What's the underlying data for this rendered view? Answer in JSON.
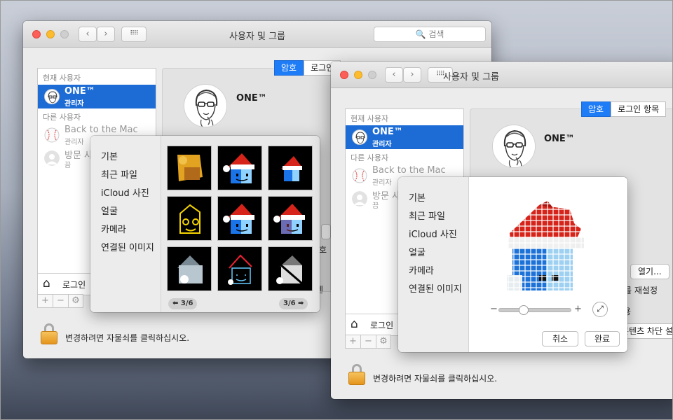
{
  "window": {
    "title": "사용자 및 그룹",
    "search_placeholder": "🔍 검색",
    "nav_back": "‹",
    "nav_forward": "›",
    "grid_icon": "⠿⠿",
    "sidebar": {
      "current_users_label": "현재 사용자",
      "other_users_label": "다른 사용자",
      "users": [
        {
          "name": "ONE™",
          "role": "관리자",
          "selected": true
        },
        {
          "name": "Back to the Mac",
          "role": "관리자"
        },
        {
          "name": "방문 사용자",
          "name_short": "방문 사",
          "role": "끔"
        }
      ],
      "login_options_short": "로그인 ",
      "add": "+",
      "remove": "−",
      "action": "⚙"
    },
    "tabs": [
      "암호",
      "로그인 항목"
    ],
    "tab_back_short": "로그인",
    "account_name": "ONE™",
    "open_button": "열기...",
    "reset_password_stub": "호를 재설정",
    "stub_ho": "호",
    "stub_tent_short": "텐",
    "stub_u": "용",
    "content_block_stub": "콘텐츠 차단 설",
    "lock_text": "변경하려면 자물쇠를 클릭하십시오."
  },
  "picture_menu": [
    "기본",
    "최근 파일",
    "iCloud 사진",
    "얼굴",
    "카메라",
    "연결된 이미지"
  ],
  "pager": {
    "prev": "⬅ 3/6",
    "next": "3/6 ➡"
  },
  "zoom": {
    "minus": "−",
    "plus": "+",
    "fit_icon": "⤢",
    "level": 0.35
  },
  "buttons": {
    "cancel": "취소",
    "done": "완료"
  },
  "colors": {
    "selection": "#1d6cd6",
    "tab_active": "#1e7cf6",
    "close": "#fc5f57",
    "minimize": "#fdbc2e",
    "santa_red": "#d6241a"
  }
}
